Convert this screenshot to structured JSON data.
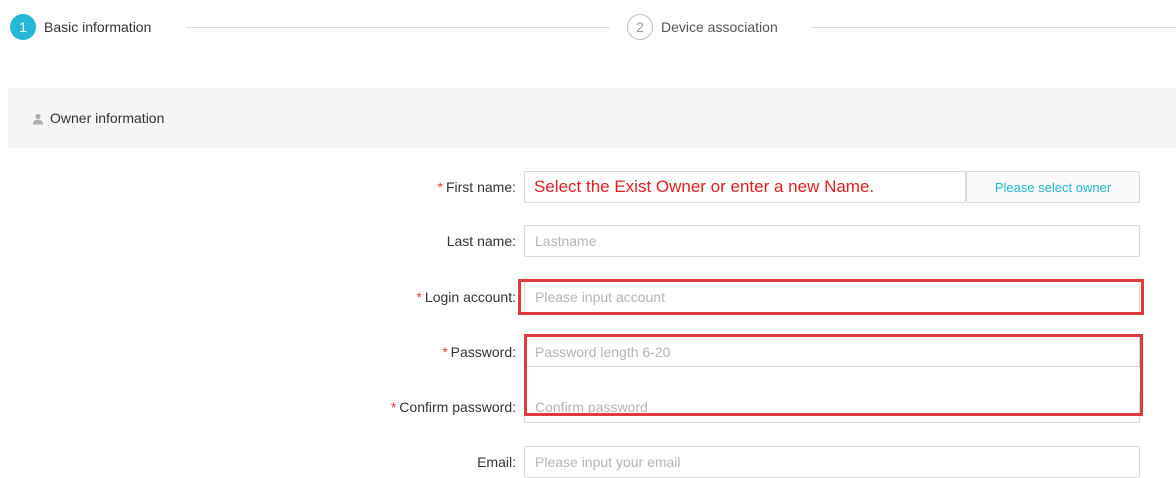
{
  "stepper": {
    "steps": [
      {
        "number": "1",
        "label": "Basic information",
        "state": "active"
      },
      {
        "number": "2",
        "label": "Device association",
        "state": "inactive"
      }
    ],
    "active_color": "#25b7d3"
  },
  "section": {
    "icon": "user-icon",
    "title": "Owner information"
  },
  "form": {
    "required_mark": "*",
    "first_name": {
      "label": "First name:",
      "value": "Select the Exist Owner or enter a new Name.",
      "button_label": "Please select owner"
    },
    "last_name": {
      "label": "Last name:",
      "placeholder": "Lastname"
    },
    "login_account": {
      "label": "Login account:",
      "placeholder": "Please input account"
    },
    "password": {
      "label": "Password:",
      "placeholder": "Password length 6-20"
    },
    "confirm_password": {
      "label": "Confirm password:",
      "placeholder": "Confirm password"
    },
    "email": {
      "label": "Email:",
      "placeholder": "Please input your email"
    }
  },
  "colors": {
    "required": "#e04545",
    "highlight": "#e0393e",
    "annotation_text": "#e02020",
    "link": "#25b7d3"
  }
}
